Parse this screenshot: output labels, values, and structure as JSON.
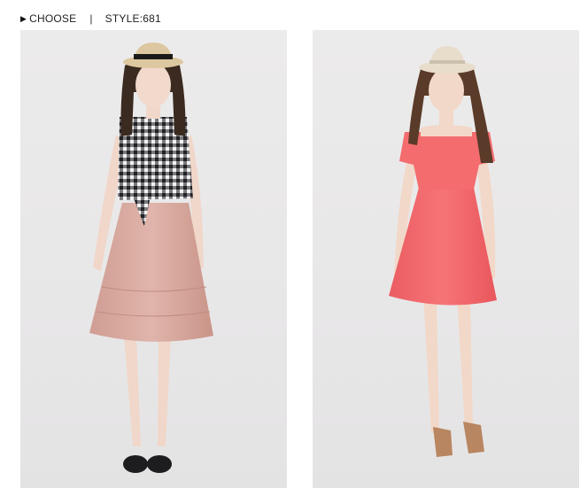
{
  "header": {
    "choose_label": "CHOOSE",
    "separator": "|",
    "style_label": "STYLE:681"
  },
  "icons": {
    "choose_marker": "play-triangle-icon"
  },
  "photos": [
    {
      "name": "model-gingham-top-pink-skirt",
      "colors": {
        "background": "#eae9ea",
        "hat": "#dcc7a0",
        "hat_band": "#1a1a1a",
        "hair": "#3a2a20",
        "skin": "#f1d9cb",
        "top": "#3b3b3f",
        "skirt": "#d8aaa0",
        "shoes": "#1d1d1f"
      }
    },
    {
      "name": "model-coral-dress",
      "colors": {
        "background": "#eae9ea",
        "hat": "#e8dccb",
        "hair": "#5a3a28",
        "skin": "#f2d8c8",
        "dress": "#f46c6e",
        "shoes": "#b88660"
      }
    }
  ]
}
